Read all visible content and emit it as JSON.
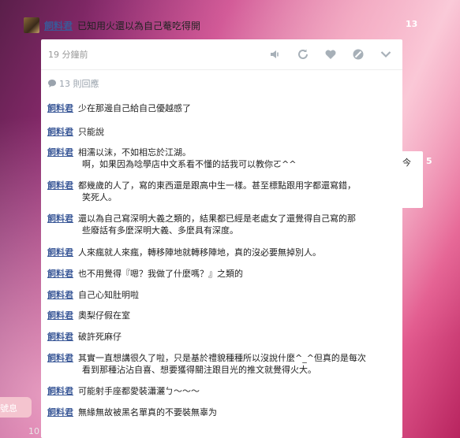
{
  "post": {
    "author": "飼料君",
    "text": "已知用火還以為自己菴吃得開",
    "time": "19 分鐘前",
    "reply_count": "13 則回應",
    "side_count": "13"
  },
  "background": {
    "right_card_text": "今",
    "right_card_count": "5",
    "left_card_text": "號息",
    "bottom_count": "10"
  },
  "icons": {
    "mute": "speaker-mute-icon",
    "repost": "repost-icon",
    "like": "heart-icon",
    "block": "block-icon",
    "expand": "chevron-down-icon"
  },
  "comments": [
    {
      "author": "飼料君",
      "lines": [
        "少在那邊自己給自己優越感了"
      ]
    },
    {
      "author": "飼料君",
      "lines": [
        "只能說"
      ]
    },
    {
      "author": "飼料君",
      "lines": [
        "相濡以沫，不如相忘於江湖。",
        "啊，如果因為唸學店中文系看不懂的話我可以教你ㄛ^^"
      ]
    },
    {
      "author": "飼料君",
      "lines": [
        "都幾歲的人了，寫的東西還是跟高中生一樣。甚至標點跟用字都還寫錯，",
        "笑死人。"
      ]
    },
    {
      "author": "飼料君",
      "lines": [
        "還以為自己寫深明大義之類的，結果都已經是老處女了還覺得自己寫的那",
        "些廢話有多麼深明大義、多麼具有深度。"
      ]
    },
    {
      "author": "飼料君",
      "lines": [
        "人來瘋就人來瘋，轉移陣地就轉移陣地，真的沒必要無掉別人。"
      ]
    },
    {
      "author": "飼料君",
      "lines": [
        "也不用覺得『嗯？我做了什麼嗎？』之類的"
      ]
    },
    {
      "author": "飼料君",
      "lines": [
        "自己心知肚明啦"
      ]
    },
    {
      "author": "飼料君",
      "lines": [
        "奧梨仔假在室"
      ]
    },
    {
      "author": "飼料君",
      "lines": [
        "破許死麻仔"
      ]
    },
    {
      "author": "飼料君",
      "lines": [
        "其實一直想講很久了啦，只是基於禮貌種種所以沒說什麼^_^但真的是每次",
        "看到那種沾沾自喜、想要獲得關注跟目光的推文就覺得火大。"
      ]
    },
    {
      "author": "飼料君",
      "lines": [
        "可能射手座都愛裝瀟灑ㄅ～～～"
      ]
    },
    {
      "author": "飼料君",
      "lines": [
        "無緣無故被黑名單真的不要裝無辜为"
      ]
    }
  ]
}
